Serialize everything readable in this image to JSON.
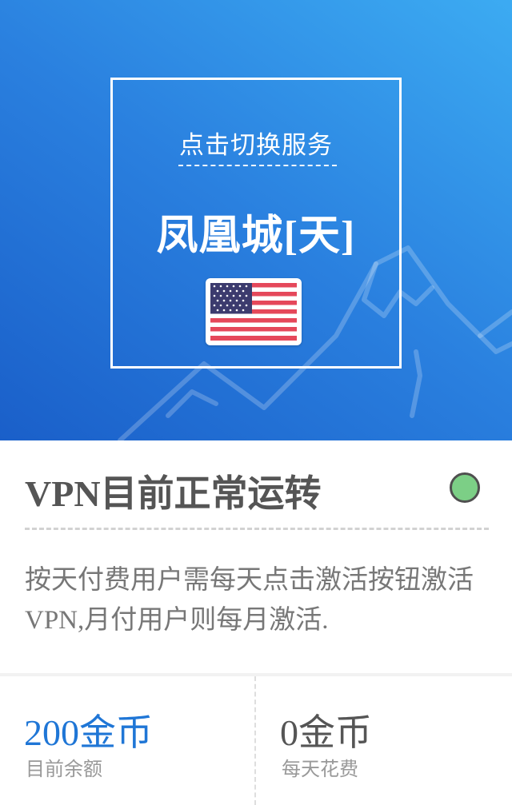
{
  "service": {
    "switch_label": "点击切换服务",
    "server_name": "凤凰城[天]",
    "flag_icon": "us-flag-icon"
  },
  "status": {
    "title": "VPN目前正常运转",
    "indicator_color": "#7ccf86",
    "description": "按天付费用户需每天点击激活按钮激活VPN,月付用户则每月激活."
  },
  "stats": {
    "balance_value": "200金币",
    "balance_label": "目前余额",
    "daily_cost_value": "0金币",
    "daily_cost_label": "每天花费"
  },
  "colors": {
    "accent": "#1f76d6",
    "hero_start": "#1a5fc9",
    "hero_end": "#3cabf2"
  }
}
